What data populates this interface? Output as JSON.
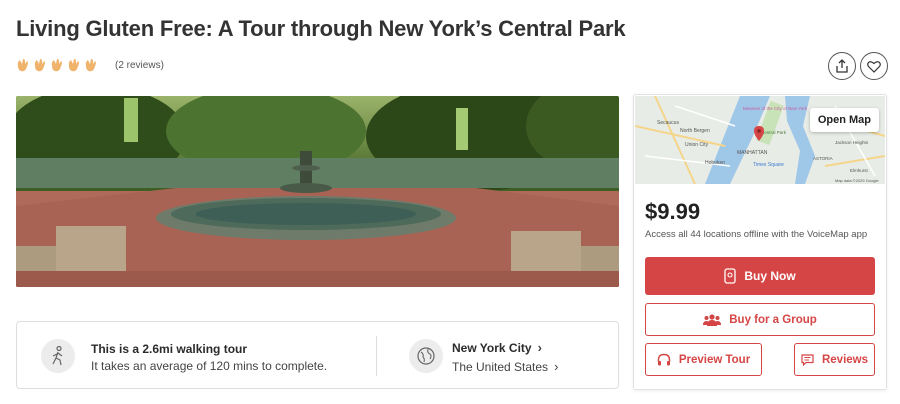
{
  "page": {
    "title": "Living Gluten Free: A Tour through New York’s Central Park",
    "reviews_label": "(2 reviews)",
    "rating": 5,
    "rating_max": 5
  },
  "actions": {
    "share_icon": "share-icon",
    "favorite_icon": "heart-icon"
  },
  "tour_info": {
    "walk_title": "This is a 2.6mi walking tour",
    "walk_subtitle": "It takes an average of 120 mins to complete.",
    "city": "New York City",
    "country": "The United States"
  },
  "sidebar": {
    "map_button": "Open Map",
    "map_labels": [
      "Secaucus",
      "North Bergen",
      "Union City",
      "Hoboken",
      "MANHATTAN",
      "Times Square",
      "Museum of the City of New York",
      "Central Park",
      "Jackson Heights",
      "ASTORIA",
      "Elmhurst",
      "Map data ©2025 Google"
    ],
    "price": "$9.99",
    "offline_text": "Access all 44 locations offline with the VoiceMap app",
    "buy_now": "Buy Now",
    "buy_group": "Buy for a Group",
    "preview": "Preview Tour",
    "reviews": "Reviews"
  },
  "colors": {
    "accent": "#d64545",
    "clap": "#f0b36b"
  }
}
